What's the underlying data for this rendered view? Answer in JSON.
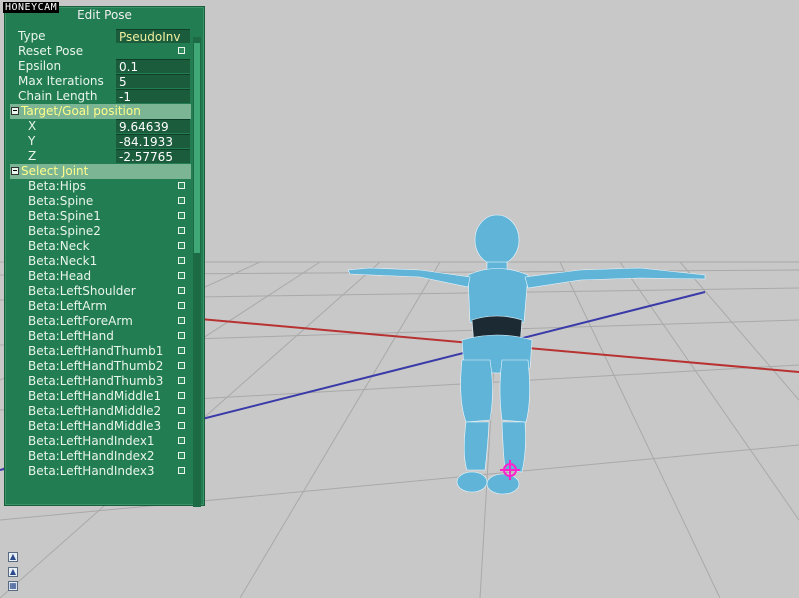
{
  "watermark": "HONEYCAM",
  "panel": {
    "title": "Edit Pose",
    "type_label": "Type",
    "type_value": "PseudoInv",
    "reset_label": "Reset Pose",
    "epsilon_label": "Epsilon",
    "epsilon_value": "0.1",
    "max_iter_label": "Max Iterations",
    "max_iter_value": "5",
    "chain_label": "Chain Length",
    "chain_value": "-1",
    "target_section": "Target/Goal position",
    "x_label": "X",
    "x_value": "9.64639",
    "y_label": "Y",
    "y_value": "-84.1933",
    "z_label": "Z",
    "z_value": "-2.57765",
    "joint_section": "Select Joint",
    "joints": [
      "Beta:Hips",
      "Beta:Spine",
      "Beta:Spine1",
      "Beta:Spine2",
      "Beta:Neck",
      "Beta:Neck1",
      "Beta:Head",
      "Beta:LeftShoulder",
      "Beta:LeftArm",
      "Beta:LeftForeArm",
      "Beta:LeftHand",
      "Beta:LeftHandThumb1",
      "Beta:LeftHandThumb2",
      "Beta:LeftHandThumb3",
      "Beta:LeftHandMiddle1",
      "Beta:LeftHandMiddle2",
      "Beta:LeftHandMiddle3",
      "Beta:LeftHandIndex1",
      "Beta:LeftHandIndex2",
      "Beta:LeftHandIndex3"
    ]
  },
  "colors": {
    "panel_bg": "#237d52",
    "section_bg": "#7bb593",
    "section_text": "#fffd8a",
    "axis_x": "#b83232",
    "axis_z": "#3a3aa8",
    "model": "#5fb4d8",
    "target_marker": "#ff22cc"
  },
  "icons": [
    "arrow-up-icon",
    "arrow-up-icon",
    "grid-icon"
  ]
}
